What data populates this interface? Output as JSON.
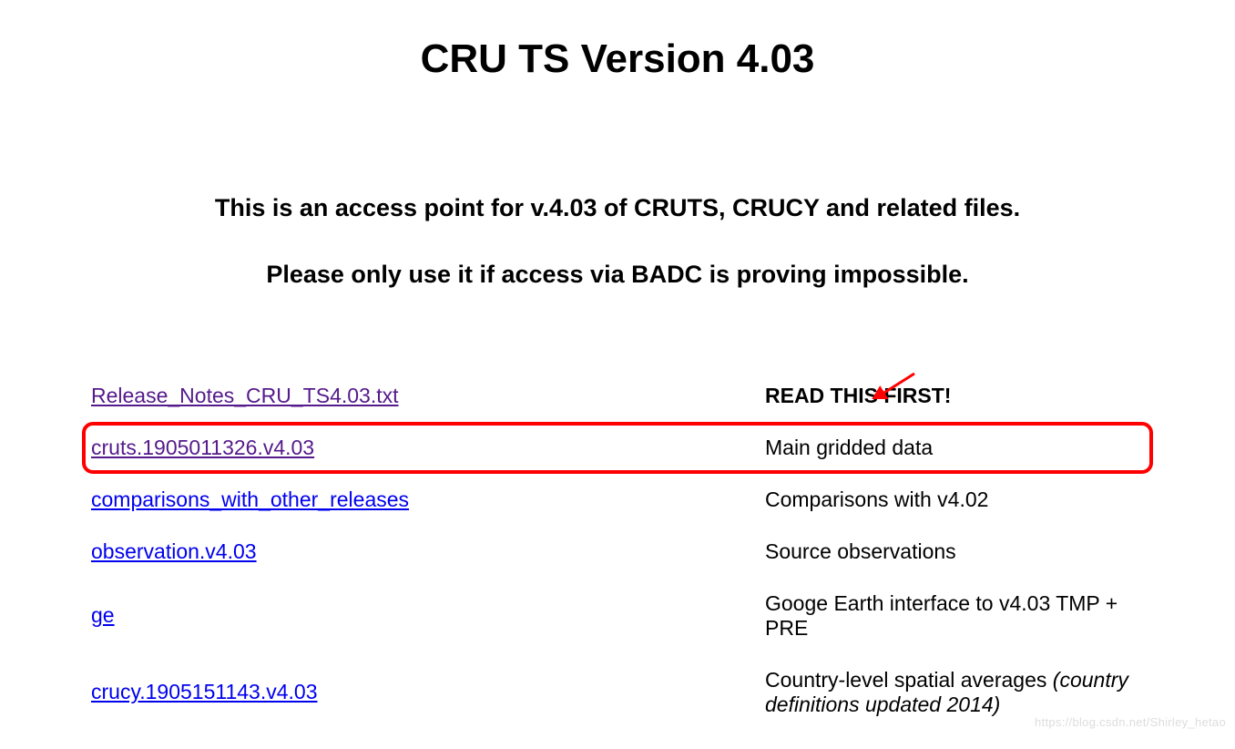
{
  "title": "CRU TS Version 4.03",
  "intro": {
    "line1": "This is an access point for v.4.03 of CRUTS, CRUCY and related files.",
    "line2": "Please only use it if access via BADC is proving impossible."
  },
  "rows": [
    {
      "link": "Release_Notes_CRU_TS4.03.txt",
      "desc": "READ THIS FIRST!",
      "bold": true,
      "visited": true,
      "arrow": true
    },
    {
      "link": "cruts.1905011326.v4.03",
      "desc": "Main gridded data",
      "highlighted": true,
      "visited": true
    },
    {
      "link": "comparisons_with_other_releases",
      "desc": "Comparisons with v4.02"
    },
    {
      "link": "observation.v4.03",
      "desc": "Source observations"
    },
    {
      "link": "ge",
      "desc": "Googe Earth interface to v4.03 TMP + PRE"
    },
    {
      "link": "crucy.1905151143.v4.03",
      "desc": "Country-level spatial averages ",
      "desc_italic": "(country definitions updated 2014)"
    }
  ],
  "watermark": "https://blog.csdn.net/Shirley_hetao"
}
